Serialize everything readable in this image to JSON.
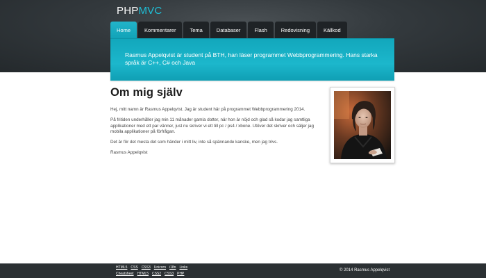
{
  "header": {
    "logo_part1": "PHP",
    "logo_part2": "MVC",
    "logo_color": "#1fc0d8"
  },
  "nav": {
    "items": [
      {
        "label": "Home",
        "active": true
      },
      {
        "label": "Kommentarer",
        "active": false
      },
      {
        "label": "Tema",
        "active": false
      },
      {
        "label": "Databaser",
        "active": false
      },
      {
        "label": "Flash",
        "active": false
      },
      {
        "label": "Redovisning",
        "active": false
      },
      {
        "label": "Källkod",
        "active": false
      }
    ],
    "accent_color": "#1cb7cc"
  },
  "hero": {
    "text": "Rasmus Appelqvist är student på BTH, han läser programmet Webbprogrammering. Hans starka språk är C++, C# och Java"
  },
  "main": {
    "title": "Om mig själv",
    "paragraphs": [
      "Hej, mitt namn är Rasmus Appelqvist. Jag är student här på programmet Webbprogrammering 2014.",
      "På fritiden underhåller jag min 11 månader gamla dotter, när hon är nöjd och glad så kodar jag samtliga applikationer med ett par vänner, just nu skriver vi ett till pc / ps4 / xbone. Utöver det skriver och säljer jag mobila applikationer på förfrågan.",
      "Det är för det mesta det som händer i mitt liv, inte så spännande kanske, men jag trivs.",
      "Rasmus Appelqvist"
    ]
  },
  "footer": {
    "row1": [
      "HTML5",
      "CSS",
      "CSS3",
      "Unicorn",
      "i18n",
      "Links"
    ],
    "row2": [
      "Cheatsheet",
      "HTML5",
      "CSS2",
      "CSS3",
      "PHP"
    ],
    "copyright": "© 2014 Rasmus Appelqvist"
  }
}
